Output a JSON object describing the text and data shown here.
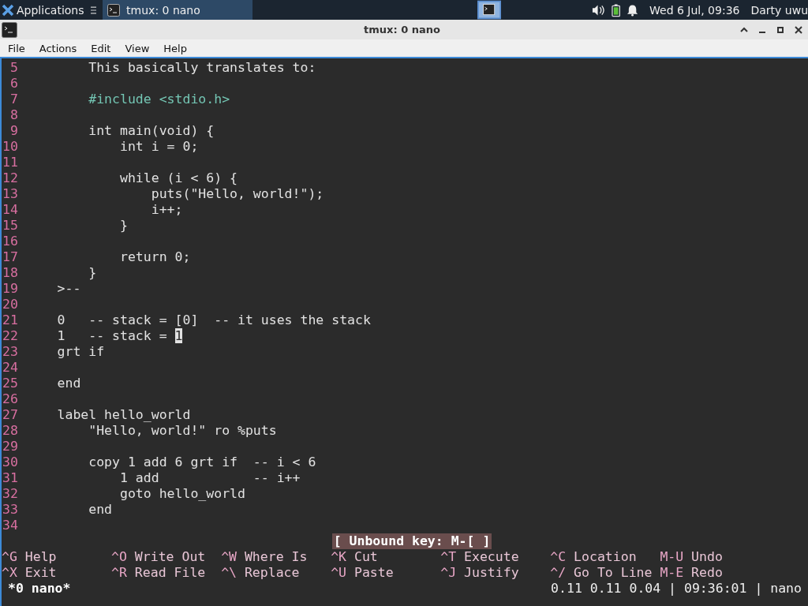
{
  "taskbar": {
    "app_menu": "Applications",
    "tasks": [
      {
        "label": "tmux: 0 nano",
        "selected": true
      }
    ],
    "clock": "Wed 6 Jul, 09:36",
    "user": "Darty uwu"
  },
  "window": {
    "title": "tmux: 0 nano"
  },
  "menu": [
    "File",
    "Actions",
    "Edit",
    "View",
    "Help"
  ],
  "editor": {
    "lines": [
      {
        "number": "5",
        "text": "        This basically translates to:",
        "kind": "text"
      },
      {
        "number": "6",
        "kind": "text"
      },
      {
        "number": "7",
        "text": "        #include <stdio.h>",
        "kind": "directive"
      },
      {
        "number": "8",
        "kind": "text"
      },
      {
        "number": "9",
        "text": "        int main(void) {",
        "kind": "text"
      },
      {
        "number": "10",
        "text": "            int i = 0;",
        "kind": "text"
      },
      {
        "number": "11",
        "kind": "text"
      },
      {
        "number": "12",
        "text": "            while (i < 6) {",
        "kind": "text"
      },
      {
        "number": "13",
        "text": "                puts(\"Hello, world!\");",
        "kind": "text"
      },
      {
        "number": "14",
        "text": "                i++;",
        "kind": "text"
      },
      {
        "number": "15",
        "text": "            }",
        "kind": "text"
      },
      {
        "number": "16",
        "kind": "text"
      },
      {
        "number": "17",
        "text": "            return 0;",
        "kind": "text"
      },
      {
        "number": "18",
        "text": "        }",
        "kind": "text"
      },
      {
        "number": "19",
        "text": "    >--",
        "kind": "text"
      },
      {
        "number": "20",
        "kind": "text"
      },
      {
        "number": "21",
        "text": "    0   -- stack = [0]  -- it uses the stack",
        "kind": "text"
      },
      {
        "number": "22",
        "text": "    1   -- stack = ",
        "cursor": "1",
        "kind": "text"
      },
      {
        "number": "23",
        "text": "    grt if",
        "kind": "text"
      },
      {
        "number": "24",
        "kind": "text"
      },
      {
        "number": "25",
        "text": "    end",
        "kind": "text"
      },
      {
        "number": "26",
        "kind": "text"
      },
      {
        "number": "27",
        "text": "    label hello_world",
        "kind": "text"
      },
      {
        "number": "28",
        "text": "        \"Hello, world!\" ro %puts",
        "kind": "text"
      },
      {
        "number": "29",
        "kind": "text"
      },
      {
        "number": "30",
        "text": "        copy 1 add 6 grt if  -- i < 6",
        "kind": "text"
      },
      {
        "number": "31",
        "text": "            1 add            -- i++",
        "kind": "text"
      },
      {
        "number": "32",
        "text": "            goto hello_world",
        "kind": "text"
      },
      {
        "number": "33",
        "text": "        end",
        "kind": "text"
      },
      {
        "number": "34",
        "kind": "text"
      }
    ]
  },
  "status_message": "[ Unbound key: M-[ ]",
  "shortcuts": [
    [
      {
        "key": "^G",
        "label": "Help"
      },
      {
        "key": "^O",
        "label": "Write Out"
      },
      {
        "key": "^W",
        "label": "Where Is"
      },
      {
        "key": "^K",
        "label": "Cut"
      },
      {
        "key": "^T",
        "label": "Execute"
      },
      {
        "key": "^C",
        "label": "Location"
      },
      {
        "key": "M-U",
        "label": "Undo"
      }
    ],
    [
      {
        "key": "^X",
        "label": "Exit"
      },
      {
        "key": "^R",
        "label": "Read File"
      },
      {
        "key": "^\\",
        "label": "Replace"
      },
      {
        "key": "^U",
        "label": "Paste"
      },
      {
        "key": "^J",
        "label": "Justify"
      },
      {
        "key": "^/",
        "label": "Go To Line"
      },
      {
        "key": "M-E",
        "label": "Redo"
      }
    ]
  ],
  "tmux_status": {
    "window": "*0 nano*",
    "right": "0.11 0.11 0.04 | 09:36:01 | nano"
  }
}
